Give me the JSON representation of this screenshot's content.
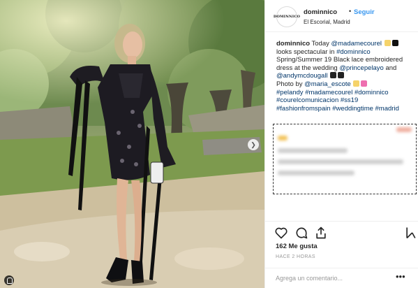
{
  "post": {
    "avatar_text": "DOMINNICO",
    "username": "dominnico",
    "dot": "•",
    "follow_label": "Seguir",
    "location": "El Escorial, Madrid"
  },
  "caption": {
    "author": "dominnico",
    "text_1": " Today ",
    "mention_1": "@madamecourel",
    "text_2": " looks spectacular in ",
    "hashtag_1": "#dominnico",
    "text_3": " Spring/Summer 19 Black lace embroidered dress at the wedding ",
    "mention_2": "@princepelayo",
    "text_4": " and ",
    "mention_3": "@andymcdougall",
    "text_5": " Photo by ",
    "mention_4": "@maria_escote",
    "hashtags_line": "#pelandy #madamecourel #dominnico #courelcomunicacion #ss19 #fashionfromspain #weddingtime #madrid"
  },
  "engagement": {
    "likes": "162 Me gusta",
    "time_ago": "HACE 2 HORAS"
  },
  "comment_box": {
    "placeholder": "Agrega un comentario...",
    "more": "•••"
  },
  "icons": {
    "like": "heart-icon",
    "comment": "comment-icon",
    "share": "share-icon",
    "save": "bookmark-icon",
    "next": "chevron-right-icon",
    "tagged_people": "user-tag-icon"
  },
  "colors": {
    "link": "#3897f0",
    "hashtag": "#003569",
    "text": "#262626",
    "muted": "#999999"
  }
}
